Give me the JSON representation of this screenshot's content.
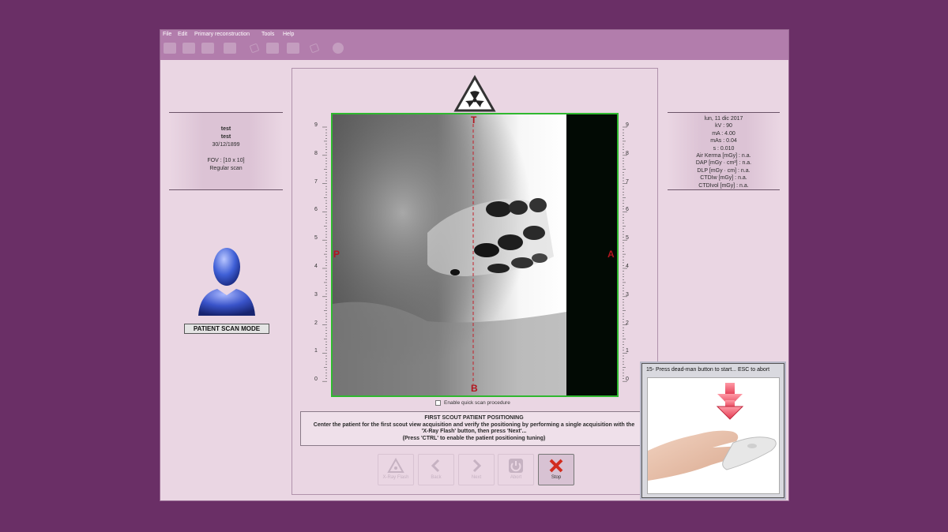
{
  "menu": [
    "File",
    "Edit",
    "Primary reconstruction",
    "Tools",
    "Help"
  ],
  "patient": {
    "name": "test",
    "surname": "test",
    "birth_date": "30/12/1899",
    "fov": "FOV : [10 x 10]",
    "scan_type": "Regular scan"
  },
  "exposure": {
    "date": "lun, 11 dic 2017",
    "kv": "kV : 90",
    "ma": "mA : 4.00",
    "mas": "mAs : 0.04",
    "s": "s : 0.010",
    "air_kerma": "Air Kerma [mGy] : n.a.",
    "dap": "DAP [mGy · cm²] : n.a.",
    "dlp": "DLP [mGy · cm] : n.a.",
    "ctdiw": "CTDIw [mGy] : n.a.",
    "ctdivol": "CTDIvol [mGy] : n.a."
  },
  "scan_mode_label": "PATIENT SCAN MODE",
  "orientation": {
    "top": "T",
    "bottom": "B",
    "left": "P",
    "right": "A"
  },
  "ruler_ticks": [
    "9",
    "8",
    "7",
    "6",
    "5",
    "4",
    "3",
    "2",
    "1",
    "0"
  ],
  "quick_scan_label": "Enable quick scan procedure",
  "instructions": {
    "title": "FIRST SCOUT PATIENT POSITIONING",
    "line1": "Center the patient for the first scout view acquisition and verify the positioning by performing a single acquisition with the",
    "line2": "'X-Ray Flash' button, then press 'Next'...",
    "line3": "(Press 'CTRL' to enable the patient positioning tuning)"
  },
  "buttons": {
    "xray_flash": "X-Ray Flash",
    "back": "Back",
    "next": "Next",
    "abort": "Abort",
    "stop": "Stop"
  },
  "popup": {
    "title": "15- Press dead-man button to start...  ESC to abort"
  },
  "colors": {
    "background": "#6a2f66",
    "menubar": "#b27dac",
    "window": "#ead6e3",
    "frame_green": "#2fb82f",
    "orientation_red": "#b3151e",
    "avatar_blue": "#3f5fd6"
  }
}
